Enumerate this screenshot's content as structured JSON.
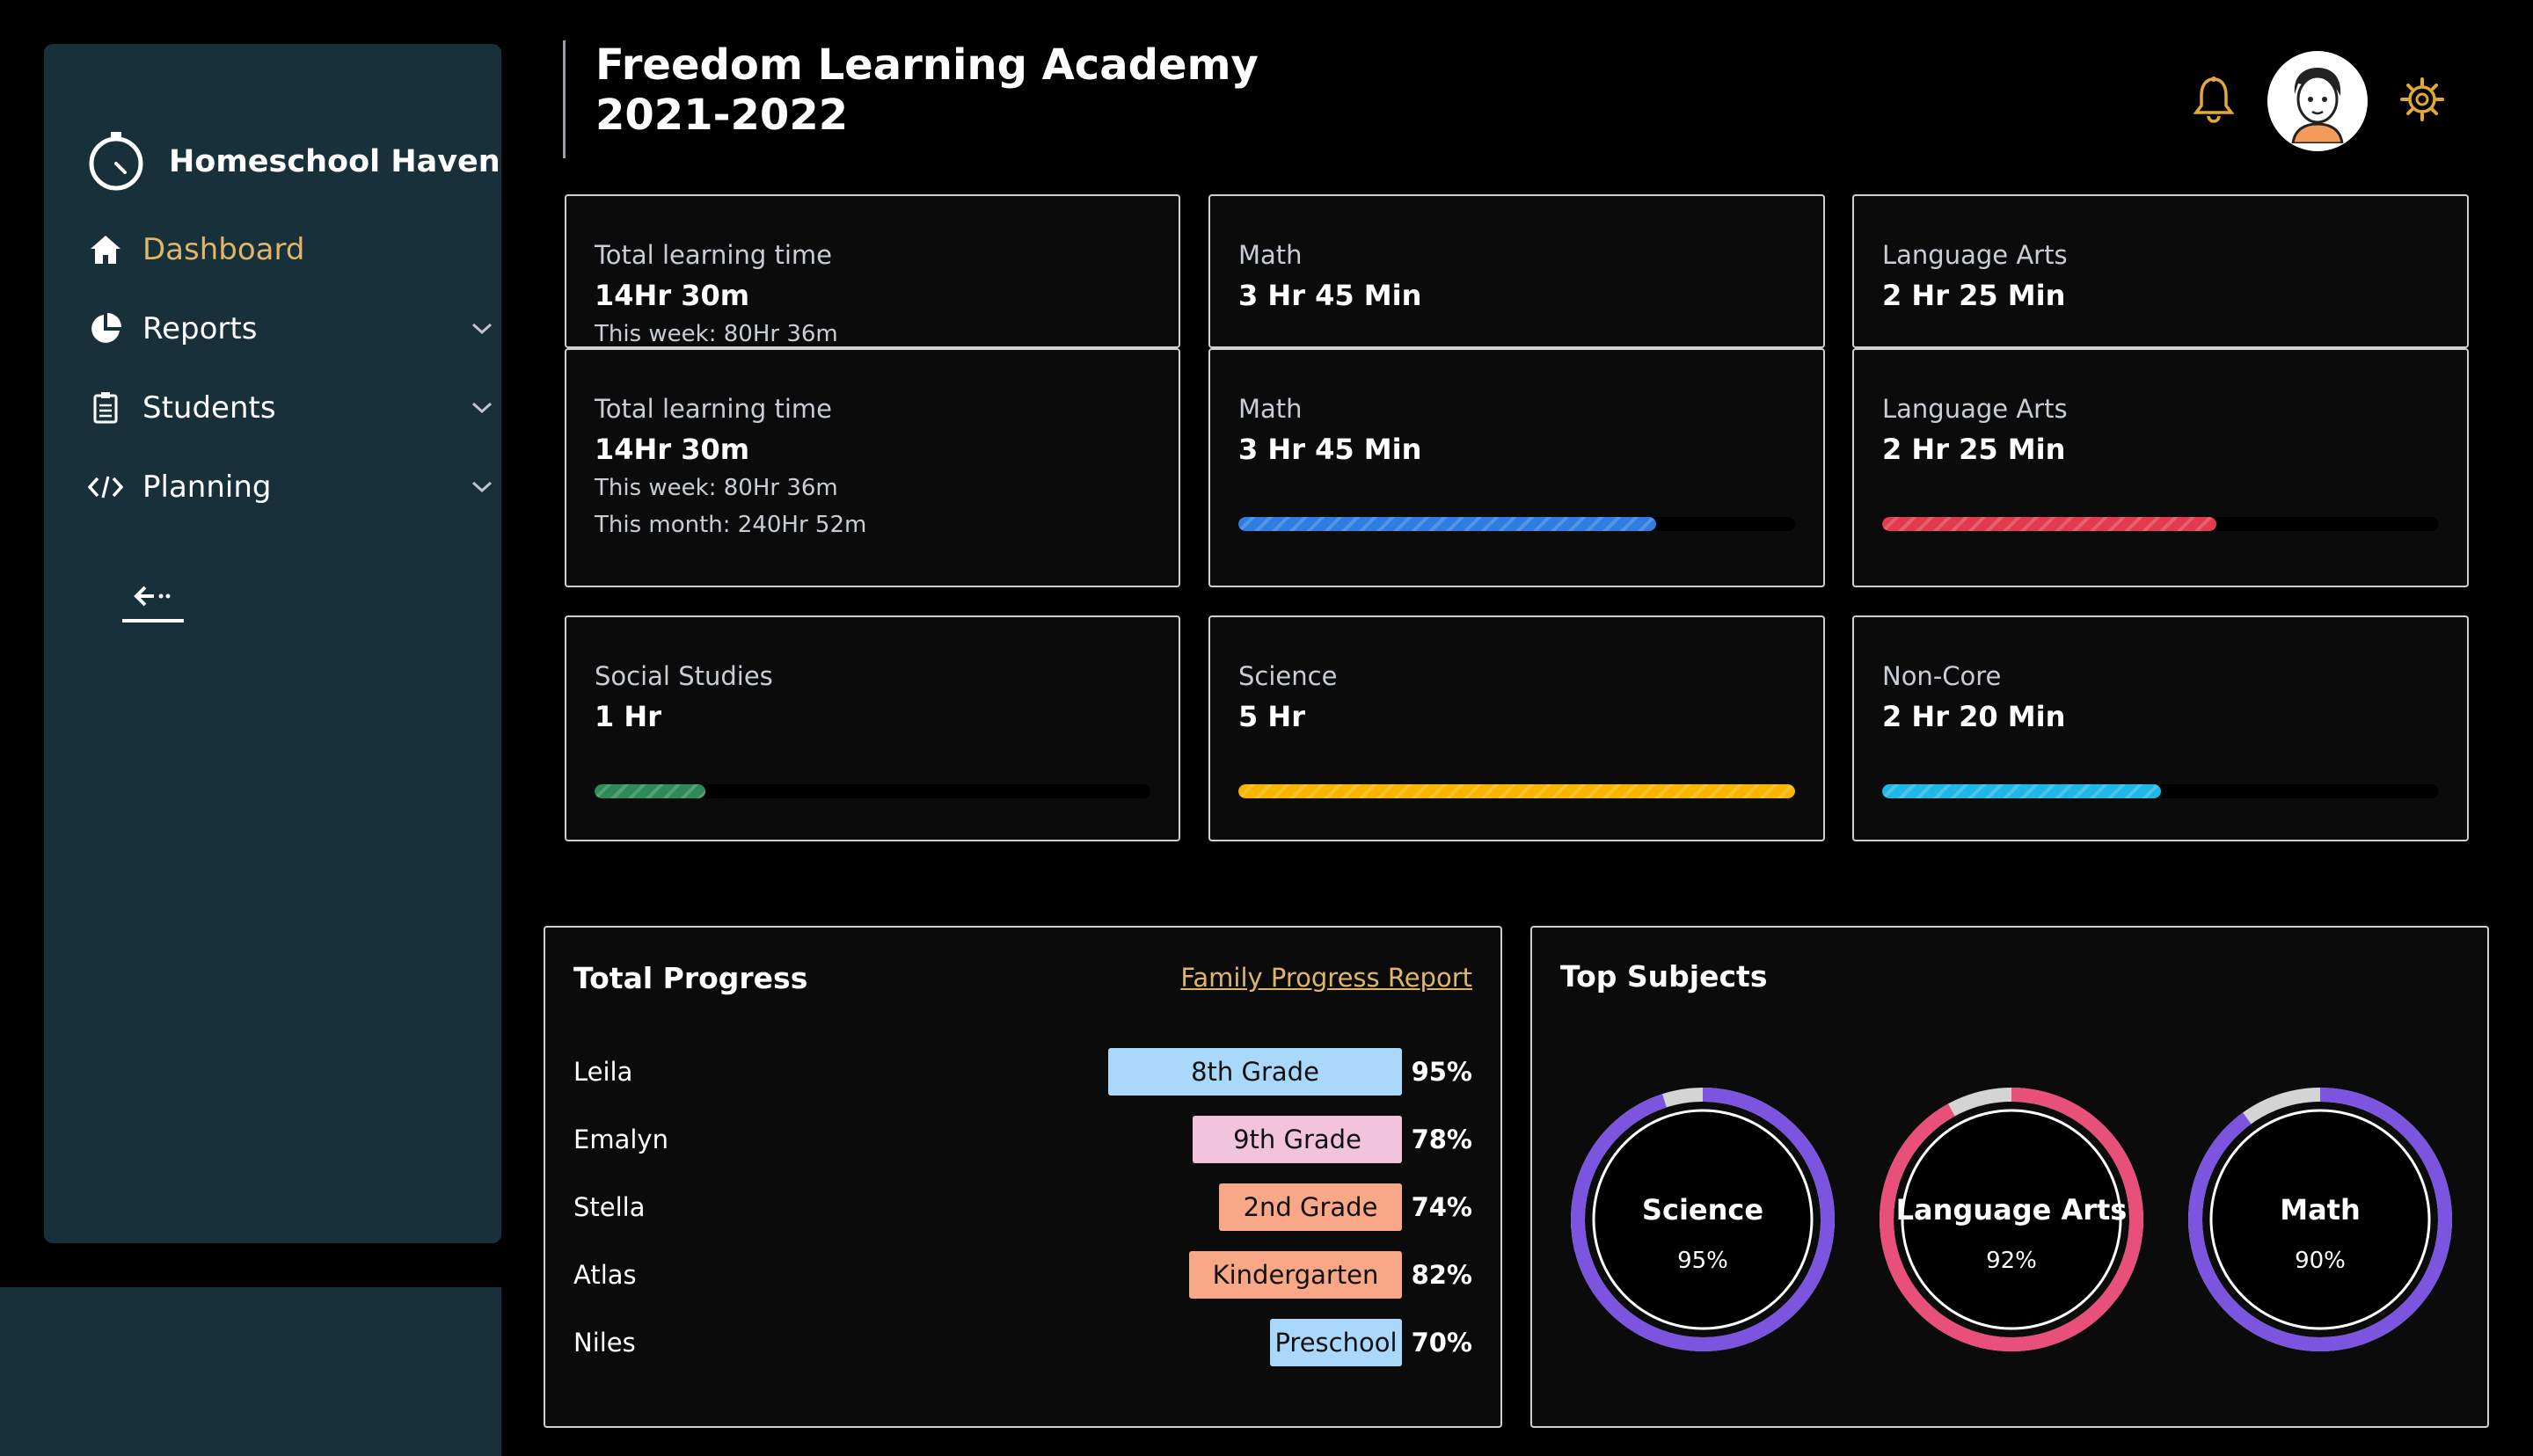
{
  "app": {
    "brand": "Homeschool Haven"
  },
  "sidebar": {
    "items": [
      {
        "label": "Dashboard",
        "icon": "home-icon"
      },
      {
        "label": "Reports",
        "icon": "pie-chart-icon"
      },
      {
        "label": "Students",
        "icon": "clipboard-icon"
      },
      {
        "label": "Planning",
        "icon": "code-icon"
      }
    ]
  },
  "header": {
    "title_line1": "Freedom Learning Academy",
    "title_line2": "2021-2022"
  },
  "stats_top": [
    {
      "label": "Total learning time",
      "value": "14Hr 30m",
      "sub": "This week: 80Hr 36m"
    },
    {
      "label": "Math",
      "value": "3 Hr 45 Min"
    },
    {
      "label": "Language Arts",
      "value": "2 Hr 25 Min"
    }
  ],
  "stats": [
    {
      "label": "Total learning time",
      "value": "14Hr 30m",
      "sub": "This week: 80Hr 36m",
      "sub2": "This month: 240Hr 52m"
    },
    {
      "label": "Math",
      "value": "3 Hr 45 Min",
      "progress": 0.75,
      "color": "#2f7de1"
    },
    {
      "label": "Language Arts",
      "value": "2 Hr 25 Min",
      "progress": 0.6,
      "color": "#e23b4e"
    },
    {
      "label": "Social Studies",
      "value": "1 Hr",
      "progress": 0.2,
      "color": "#2e8b57"
    },
    {
      "label": "Science",
      "value": "5 Hr",
      "progress": 1.0,
      "color": "#f7b500"
    },
    {
      "label": "Non-Core",
      "value": "2 Hr 20 Min",
      "progress": 0.5,
      "color": "#1fb8e6"
    }
  ],
  "progress": {
    "title": "Total Progress",
    "link": "Family Progress Report",
    "students": [
      {
        "name": "Leila",
        "grade": "8th Grade",
        "pct": "95%",
        "color": "#aad8fb"
      },
      {
        "name": "Emalyn",
        "grade": "9th Grade",
        "pct": "78%",
        "color": "#f1c4dc"
      },
      {
        "name": "Stella",
        "grade": "2nd Grade",
        "pct": "74%",
        "color": "#f8a886"
      },
      {
        "name": "Atlas",
        "grade": "Kindergarten",
        "pct": "82%",
        "color": "#f8a886"
      },
      {
        "name": "Niles",
        "grade": "Preschool",
        "pct": "70%",
        "color": "#aad8fb"
      }
    ]
  },
  "top_subjects": {
    "title": "Top Subjects",
    "items": [
      {
        "name": "Science",
        "pct": "95%",
        "value": 0.95,
        "color": "#7b55e0"
      },
      {
        "name": "Language Arts",
        "pct": "92%",
        "value": 0.92,
        "color": "#e8507a"
      },
      {
        "name": "Math",
        "pct": "90%",
        "value": 0.9,
        "color": "#7b55e0"
      }
    ]
  }
}
